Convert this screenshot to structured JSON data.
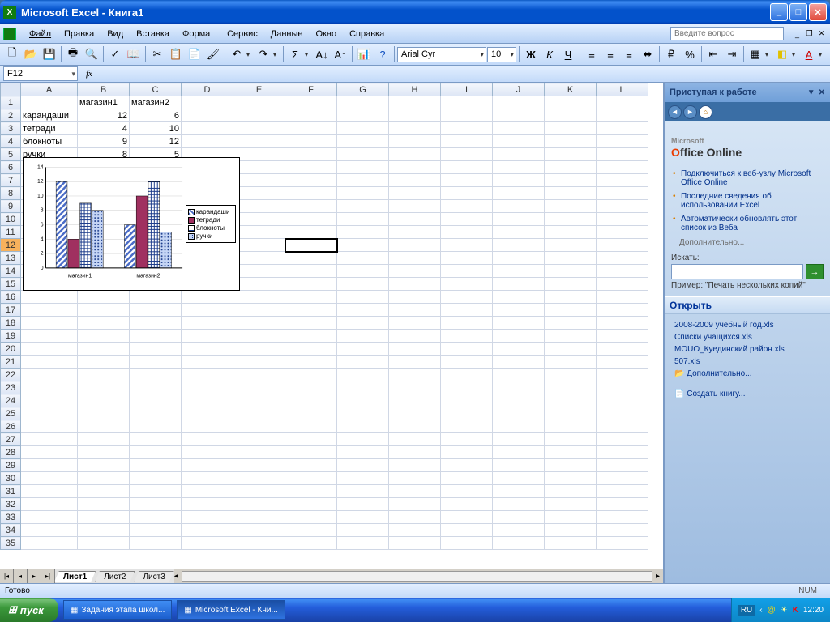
{
  "titlebar": {
    "app": "Microsoft Excel",
    "doc": "Книга1"
  },
  "menu": {
    "file": "Файл",
    "edit": "Правка",
    "view": "Вид",
    "insert": "Вставка",
    "format": "Формат",
    "tools": "Сервис",
    "data": "Данные",
    "window": "Окно",
    "help": "Справка"
  },
  "help_placeholder": "Введите вопрос",
  "font": {
    "name": "Arial Cyr",
    "size": "10"
  },
  "name_box": "F12",
  "fx": "fx",
  "columns": [
    "A",
    "B",
    "C",
    "D",
    "E",
    "F",
    "G",
    "H",
    "I",
    "J",
    "K",
    "L"
  ],
  "headers": {
    "b": "магазин1",
    "c": "магазин2"
  },
  "rows": [
    {
      "label": "карандаши",
      "v1": "12",
      "v2": "6"
    },
    {
      "label": "тетради",
      "v1": "4",
      "v2": "10"
    },
    {
      "label": "блокноты",
      "v1": "9",
      "v2": "12"
    },
    {
      "label": "ручки",
      "v1": "8",
      "v2": "5"
    }
  ],
  "active_cell": "F12",
  "chart_data": {
    "type": "bar",
    "categories": [
      "магазин1",
      "магазин2"
    ],
    "series": [
      {
        "name": "карандаши",
        "values": [
          12,
          6
        ],
        "color": "#4a6cc7",
        "pattern": "diag"
      },
      {
        "name": "тетради",
        "values": [
          4,
          10
        ],
        "color": "#a03060",
        "pattern": "solid"
      },
      {
        "name": "блокноты",
        "values": [
          9,
          12
        ],
        "color": "#f0f0a0",
        "pattern": "grid-navy"
      },
      {
        "name": "ручки",
        "values": [
          8,
          5
        ],
        "color": "#5a9bd5",
        "pattern": "dots"
      }
    ],
    "ylim": [
      0,
      14
    ],
    "yticks": [
      0,
      2,
      4,
      6,
      8,
      10,
      12,
      14
    ],
    "xlabel": "",
    "ylabel": "",
    "title": ""
  },
  "sheets": {
    "s1": "Лист1",
    "s2": "Лист2",
    "s3": "Лист3"
  },
  "taskpane": {
    "title": "Приступая к работе",
    "office": "Office Online",
    "links": [
      "Подключиться к веб-узлу Microsoft Office Online",
      "Последние сведения об использовании Excel",
      "Автоматически обновлять этот список из Веба"
    ],
    "more": "Дополнительно...",
    "search_label": "Искать:",
    "example": "Пример: \"Печать нескольких копий\"",
    "open": "Открыть",
    "files": [
      "2008-2009 учебный год.xls",
      "Списки учащихся.xls",
      "MOUO_Куединский район.xls",
      "507.xls"
    ],
    "more2": "Дополнительно...",
    "new": "Создать книгу..."
  },
  "status": {
    "ready": "Готово",
    "num": "NUM"
  },
  "taskbar": {
    "start": "пуск",
    "items": [
      "Задания этапа школ...",
      "Microsoft Excel - Кни..."
    ],
    "lang": "RU",
    "clock": "12:20"
  }
}
